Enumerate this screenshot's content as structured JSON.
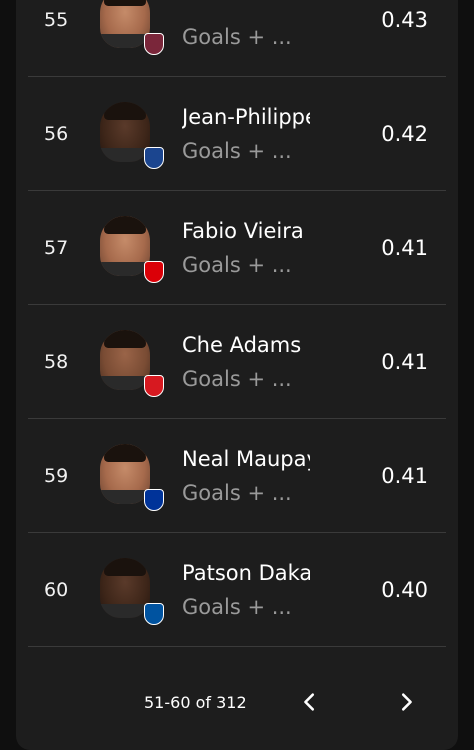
{
  "rows": [
    {
      "rank": "55",
      "name": "",
      "stat": "Goals + ...",
      "value": "0.43",
      "crest_color": "#7a263a",
      "crest_icon": "west-ham-crest-icon"
    },
    {
      "rank": "56",
      "name": "Jean-Philippe",
      "stat": "Goals + ...",
      "value": "0.42",
      "crest_color": "#1b458f",
      "crest_icon": "crystal-palace-crest-icon"
    },
    {
      "rank": "57",
      "name": "Fabio Vieira",
      "stat": "Goals + ...",
      "value": "0.41",
      "crest_color": "#db0007",
      "crest_icon": "arsenal-crest-icon"
    },
    {
      "rank": "58",
      "name": "Che Adams",
      "stat": "Goals + ...",
      "value": "0.41",
      "crest_color": "#d71920",
      "crest_icon": "southampton-crest-icon"
    },
    {
      "rank": "59",
      "name": "Neal Maupay",
      "stat": "Goals + ...",
      "value": "0.41",
      "crest_color": "#003399",
      "crest_icon": "everton-crest-icon"
    },
    {
      "rank": "60",
      "name": "Patson Daka",
      "stat": "Goals + ...",
      "value": "0.40",
      "crest_color": "#0053a0",
      "crest_icon": "leicester-crest-icon"
    }
  ],
  "pagination": {
    "range_label": "51-60 of 312",
    "prev_icon": "chevron-left-icon",
    "next_icon": "chevron-right-icon"
  }
}
